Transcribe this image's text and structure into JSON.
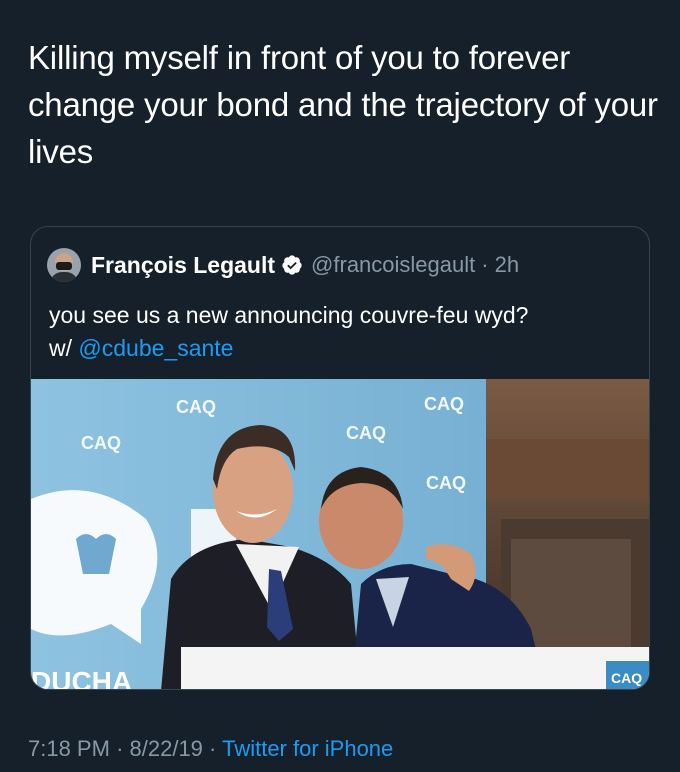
{
  "tweet": {
    "text": "Killing myself in front of you to forever change your bond and the trajectory of your lives",
    "time": "7:18 PM",
    "date": "8/22/19",
    "separator": "·",
    "source": "Twitter for iPhone"
  },
  "quoted_tweet": {
    "display_name": "François Legault",
    "handle": "@francoislegault",
    "separator": "·",
    "time_ago": "2h",
    "text_prefix": "you see us a new announcing couvre-feu wyd?",
    "text_w": "w/",
    "mention": "@cdube_sante",
    "verified_icon": "verified-badge-icon",
    "photo": {
      "backdrop_logo_text": "CAQ",
      "backdrop_bottom_text": "DUCHA",
      "podium_logo_text": "CAQ"
    }
  },
  "colors": {
    "background": "#15202b",
    "text": "#ffffff",
    "secondary": "#8899a6",
    "link": "#1d9bf0",
    "border": "#38444d"
  }
}
